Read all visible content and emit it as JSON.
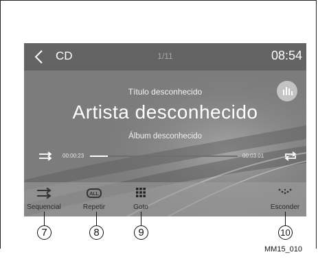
{
  "header": {
    "title": "CD",
    "track_position": "1/11",
    "clock": "08:54"
  },
  "now_playing": {
    "song": "Título desconhecido",
    "artist": "Artista desconhecido",
    "album": "Álbum desconhecido",
    "elapsed": "00:00:23",
    "total": "00:03:01",
    "progress": 0.12
  },
  "controls": [
    {
      "label": "Sequencial",
      "icon": "sequential-icon"
    },
    {
      "label": "Repetir",
      "icon": "repeat-all-icon"
    },
    {
      "label": "Goto",
      "icon": "grid-icon"
    },
    {
      "label": "Esconder",
      "icon": "hide-icon"
    }
  ],
  "callouts": [
    "7",
    "8",
    "9",
    "10"
  ],
  "figure_code": "MM15_010",
  "colors": {
    "screen_bg": "#7f7f7f",
    "topbar": "#5a5a5a",
    "bottombar": "#a6a6a6",
    "text": "#ffffff"
  }
}
